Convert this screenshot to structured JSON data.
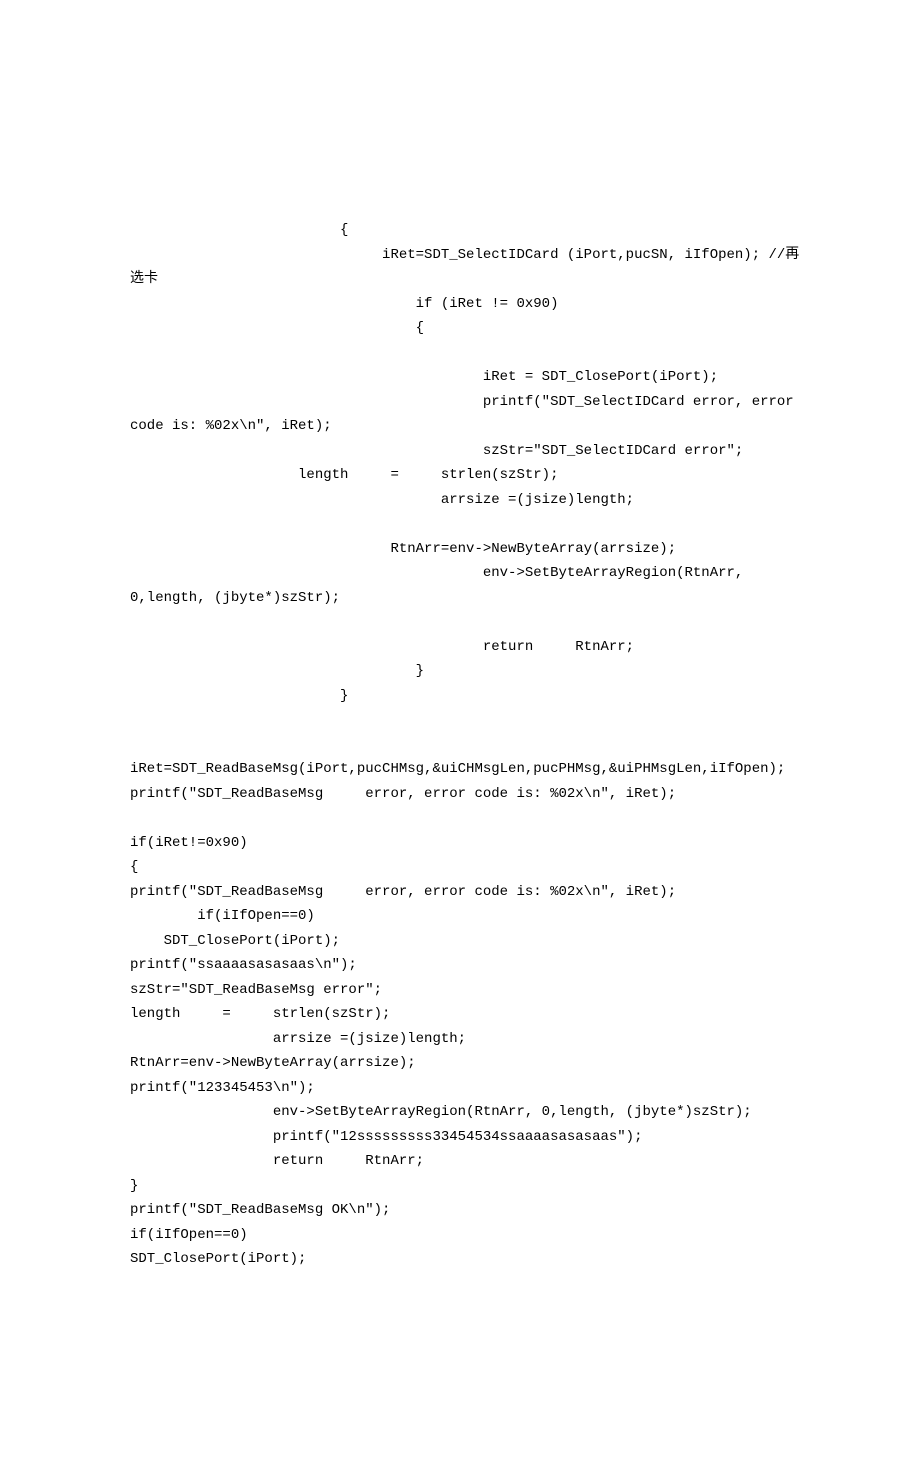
{
  "lines": [
    "                         {",
    "                              iRet=SDT_SelectIDCard (iPort,pucSN, iIfOpen); //再",
    "选卡",
    "                                  if (iRet != 0x90)",
    "                                  {",
    "",
    "                                          iRet = SDT_ClosePort(iPort);",
    "                                          printf(\"SDT_SelectIDCard error, error",
    "code is: %02x\\n\", iRet);",
    "                                          szStr=\"SDT_SelectIDCard error\";",
    "                    length     =     strlen(szStr);",
    "                                     arrsize =(jsize)length;",
    "",
    "                               RtnArr=env->NewByteArray(arrsize);",
    "                                          env->SetByteArrayRegion(RtnArr,",
    "0,length, (jbyte*)szStr);",
    "",
    "                                          return     RtnArr;",
    "                                  }",
    "                         }",
    "",
    "",
    "iRet=SDT_ReadBaseMsg(iPort,pucCHMsg,&uiCHMsgLen,pucPHMsg,&uiPHMsgLen,iIfOpen);",
    "printf(\"SDT_ReadBaseMsg     error, error code is: %02x\\n\", iRet);",
    "",
    "if(iRet!=0x90)",
    "{",
    "printf(\"SDT_ReadBaseMsg     error, error code is: %02x\\n\", iRet);",
    "        if(iIfOpen==0)",
    "    SDT_ClosePort(iPort);",
    "printf(\"ssaaaasasasaas\\n\");",
    "szStr=\"SDT_ReadBaseMsg error\";",
    "length     =     strlen(szStr);",
    "                 arrsize =(jsize)length;",
    "RtnArr=env->NewByteArray(arrsize);",
    "printf(\"123345453\\n\");",
    "                 env->SetByteArrayRegion(RtnArr, 0,length, (jbyte*)szStr);",
    "                 printf(\"12sssssssss33454534ssaaaasasasaas\");",
    "                 return     RtnArr;",
    "}",
    "printf(\"SDT_ReadBaseMsg OK\\n\");",
    "if(iIfOpen==0)",
    "SDT_ClosePort(iPort);"
  ]
}
